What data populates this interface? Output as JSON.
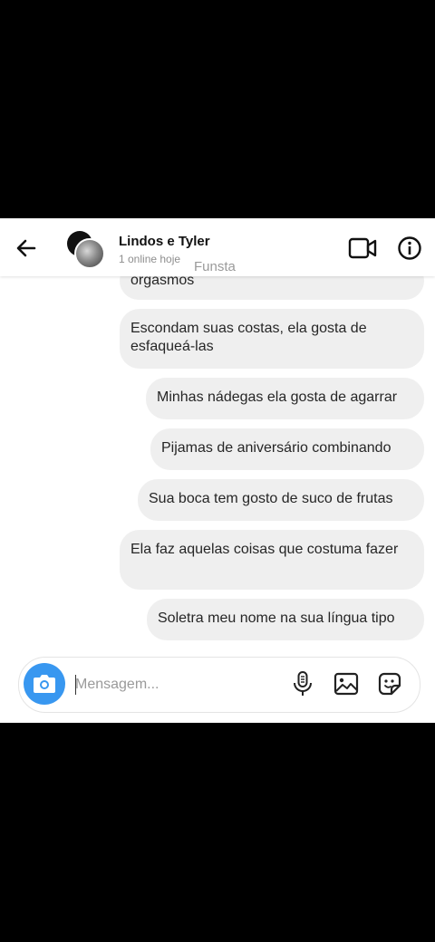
{
  "header": {
    "title": "Lindos e Tyler",
    "status": "1 online hoje",
    "watermark": "Funsta",
    "back_icon": "arrow-left-icon",
    "video_icon": "video-camera-icon",
    "info_icon": "info-icon"
  },
  "messages": [
    {
      "text": "orgasmos"
    },
    {
      "text": "Escondam suas costas, ela gosta de esfaqueá-las"
    },
    {
      "text": "Minhas nádegas ela gosta de agarrar"
    },
    {
      "text": "Pijamas de aniversário combinando"
    },
    {
      "text": "Sua boca tem gosto de suco de frutas"
    },
    {
      "text": "Ela faz aquelas coisas que costuma fazer"
    },
    {
      "text": "Soletra meu nome na sua língua tipo"
    }
  ],
  "composer": {
    "placeholder": "Mensagem...",
    "camera_icon": "camera-icon",
    "mic_icon": "microphone-icon",
    "gallery_icon": "gallery-icon",
    "sticker_icon": "sticker-icon"
  },
  "colors": {
    "accent": "#3897f0",
    "bubble": "#efefef",
    "text": "#262626"
  }
}
